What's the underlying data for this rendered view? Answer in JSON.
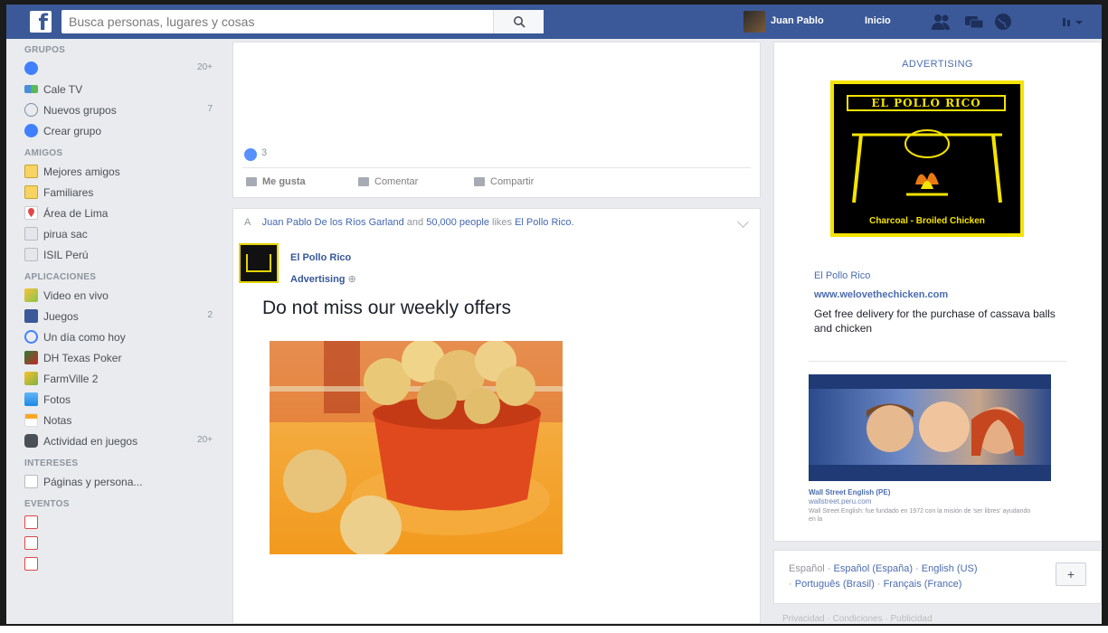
{
  "topbar": {
    "logo_letter": "f",
    "search_placeholder": "Busca personas, lugares y cosas",
    "user_name": "Juan Pablo",
    "home_label": "Inicio"
  },
  "leftnav": {
    "groups_title": "GRUPOS",
    "groups": [
      {
        "label": "",
        "count": "20+"
      },
      {
        "label": "Cale TV",
        "count": ""
      },
      {
        "label": "Nuevos grupos",
        "count": "7"
      },
      {
        "label": "Crear grupo",
        "count": ""
      }
    ],
    "friends_title": "AMIGOS",
    "friends": [
      {
        "label": "Mejores amigos"
      },
      {
        "label": "Familiares"
      },
      {
        "label": "Área de Lima"
      },
      {
        "label": "pirua sac"
      },
      {
        "label": "ISIL Perú"
      }
    ],
    "apps_title": "APLICACIONES",
    "apps": [
      {
        "label": "Video en vivo",
        "count": ""
      },
      {
        "label": "Juegos",
        "count": "2"
      },
      {
        "label": "Un día como hoy",
        "count": ""
      },
      {
        "label": "DH Texas Poker",
        "count": ""
      },
      {
        "label": "FarmVille 2",
        "count": ""
      },
      {
        "label": "Fotos",
        "count": ""
      },
      {
        "label": "Notas",
        "count": ""
      },
      {
        "label": "Actividad en juegos",
        "count": "20+"
      }
    ],
    "interests_title": "INTERESES",
    "interests": [
      {
        "label": "Páginas y persona..."
      }
    ],
    "events_title": "EVENTOS"
  },
  "post1": {
    "like_count": "3",
    "like_label": "Me gusta",
    "comment_label": "Comentar",
    "share_label": "Compartir"
  },
  "post2": {
    "story_prefix": "A",
    "story_friend": "Juan Pablo De los Ríos Garland",
    "story_and": "and",
    "story_others": "50,000 people",
    "story_likes": "likes",
    "story_page": "El Pollo Rico.",
    "page_name": "El Pollo Rico",
    "sponsored_label": "Advertising",
    "text": "Do not miss our weekly offers"
  },
  "right_ad": {
    "header": "ADVERTISING",
    "logo_title": "EL POLLO RICO",
    "logo_subtitle": "Charcoal - Broiled Chicken",
    "name": "El Pollo Rico",
    "url": "www.welovethechicken.com",
    "description": "Get free delivery for the purchase of cassava balls and chicken",
    "ad2_title": "Wall Street English (PE)",
    "ad2_url": "wallstreet.peru.com",
    "ad2_description": "Wall Street English: fue fundado en 1972 con la misión de 'ser libres' ayudando en la"
  },
  "languages": {
    "current": "Español",
    "links_line1": [
      "Español (España)",
      "English (US)"
    ],
    "links_line2": [
      "Português (Brasil)",
      "Français (France)"
    ],
    "add_label": "+"
  },
  "footer": "Privacidad · Condiciones · Publicidad"
}
